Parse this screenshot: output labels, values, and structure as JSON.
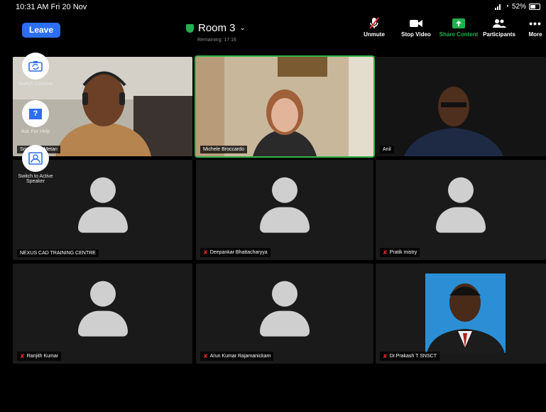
{
  "status_bar": {
    "time": "10:31 AM  Fri 20 Nov",
    "battery": "52%"
  },
  "toolbar": {
    "leave": "Leave",
    "room_title": "Room 3",
    "remaining": "Remaining: 17:16",
    "unmute": "Unmute",
    "stop_video": "Stop Video",
    "share_content": "Share Content",
    "participants": "Participants",
    "more": "More"
  },
  "side_controls": {
    "switch_camera": "Switch Camera",
    "ask_for_help": "Ask For Help",
    "switch_active_speaker": "Switch to Active Speaker"
  },
  "tiles": [
    {
      "name": "Srinivas S Metan"
    },
    {
      "name": "Michele Broccardo"
    },
    {
      "name": "Anil"
    },
    {
      "name": "NEXUS CAD TRAINING CENTRE"
    },
    {
      "name": "Deepankar Bhattacharyya"
    },
    {
      "name": "Pratik mistry"
    },
    {
      "name": "Ranjith Kumar"
    },
    {
      "name": "Arun Kumar Rajamanickam"
    },
    {
      "name": "Dr.Prakash T SNSCT"
    }
  ],
  "colors": {
    "leave": "#2d6ff3",
    "share": "#20b14e",
    "active_border": "#35b34a",
    "muted": "#e8262a"
  }
}
